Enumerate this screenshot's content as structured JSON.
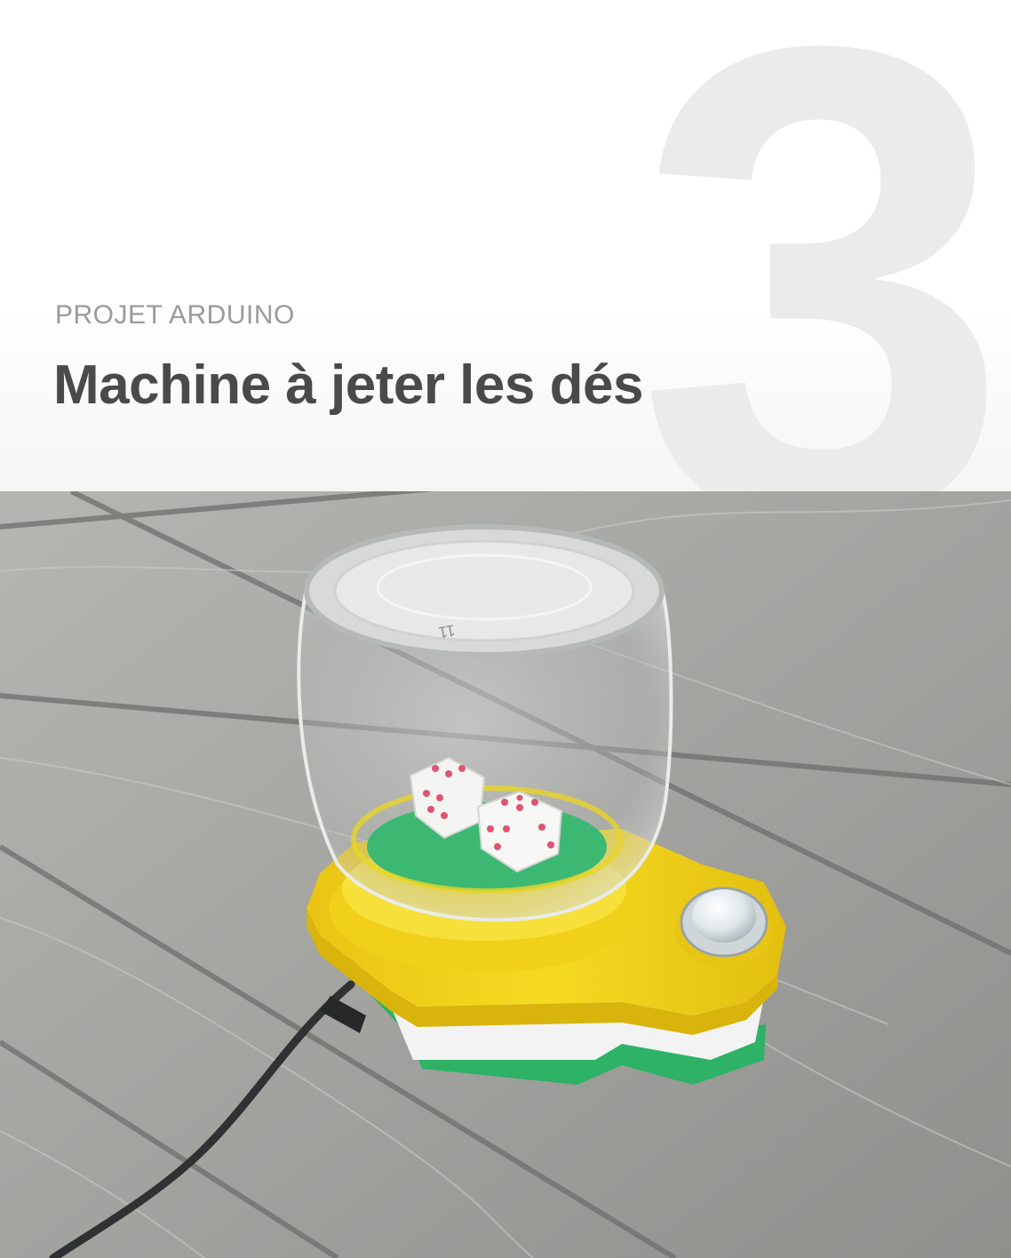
{
  "chapter": {
    "number": "3",
    "kicker": "PROJET ARDUINO",
    "title": "Machine à jeter les dés"
  },
  "photo": {
    "subject": "dice-machine",
    "jar_marking": "11"
  },
  "colors": {
    "title": "#4a4a4a",
    "kicker": "#9a9a9a",
    "big_number": "#ebebeb",
    "yellow": "#f2d41a",
    "green": "#2db266",
    "white_layer": "#f3f3f3",
    "wood": "#a9a9a5",
    "pips": "#e05470"
  }
}
